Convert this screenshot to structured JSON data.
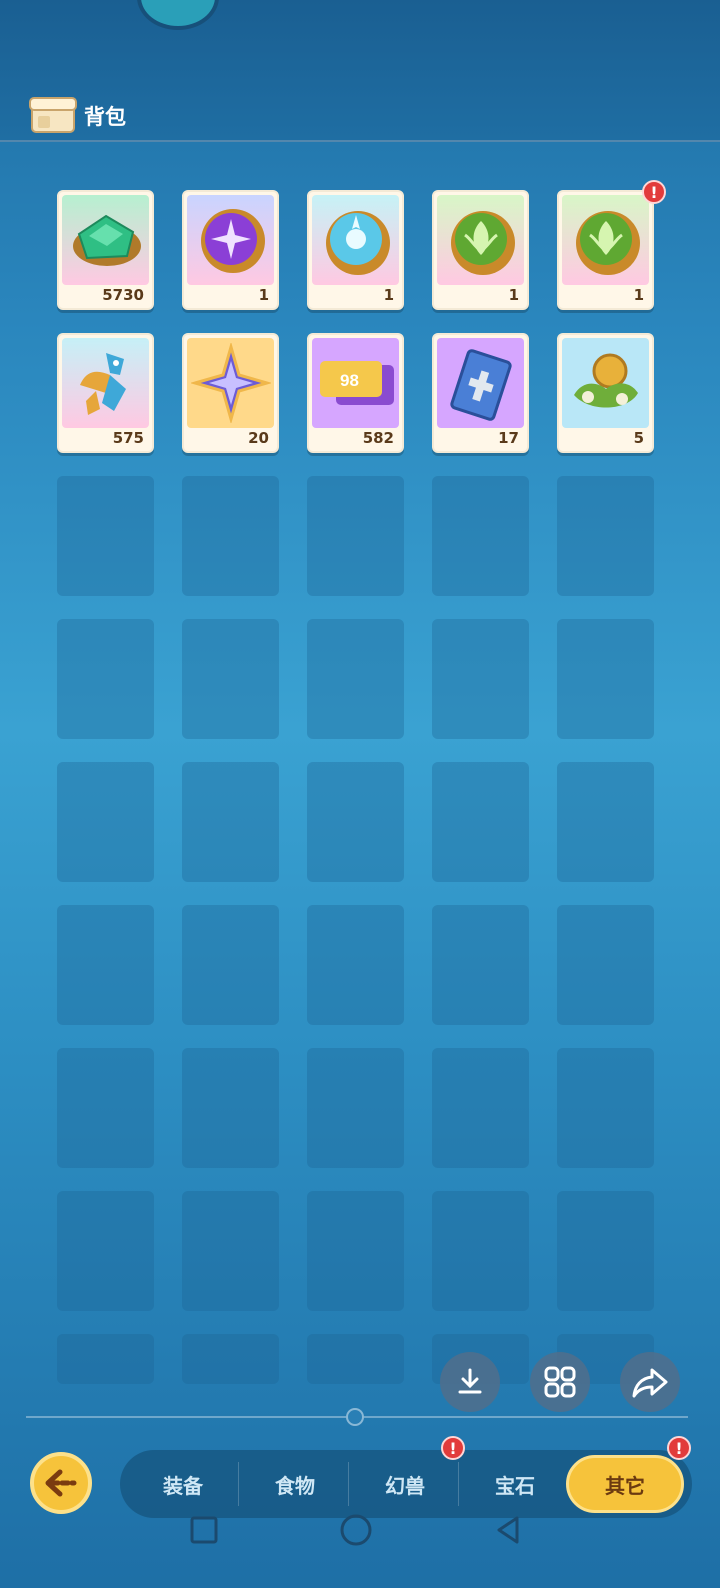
{
  "header": {
    "title": "背包",
    "bag_icon": "bag-icon"
  },
  "items": [
    {
      "count": "5730",
      "icon": "green-gem-icon",
      "bg": "#b6f0d0",
      "alert": false
    },
    {
      "count": "1",
      "icon": "purple-gear-gem-icon",
      "bg": "#ffd0e6",
      "alert": false
    },
    {
      "count": "1",
      "icon": "blue-gear-gem-icon",
      "bg": "#c6f2f6",
      "alert": false
    },
    {
      "count": "1",
      "icon": "leaf-gear-gem-icon",
      "bg": "#d8f6c7",
      "alert": false
    },
    {
      "count": "1",
      "icon": "leaf-gear-gem-icon",
      "bg": "#d8f6c7",
      "alert": true
    },
    {
      "count": "575",
      "icon": "mecha-creature-icon",
      "bg": "#c6f0f7",
      "alert": false
    },
    {
      "count": "20",
      "icon": "purple-star-icon",
      "bg": "#ffd98a",
      "alert": false
    },
    {
      "count": "582",
      "icon": "ticket-98-icon",
      "bg": "#d6a6ff",
      "alert": false,
      "label": "98"
    },
    {
      "count": "17",
      "icon": "card-icon",
      "bg": "#d6a6ff",
      "alert": false
    },
    {
      "count": "5",
      "icon": "gold-coin-plant-icon",
      "bg": "#b9e7f7",
      "alert": false
    }
  ],
  "actions": {
    "download_icon": "download-icon",
    "grid_icon": "grid-view-icon",
    "share_icon": "share-icon"
  },
  "tabs": [
    {
      "label": "装备",
      "active": false,
      "alert": false
    },
    {
      "label": "食物",
      "active": false,
      "alert": false
    },
    {
      "label": "幻兽",
      "active": false,
      "alert": true
    },
    {
      "label": "宝石",
      "active": false,
      "alert": false
    },
    {
      "label": "其它",
      "active": true,
      "alert": true
    }
  ],
  "alert_mark": "!",
  "colors": {
    "accent": "#f6c33b",
    "alert": "#e23b3b",
    "background": "#2a86bd"
  }
}
